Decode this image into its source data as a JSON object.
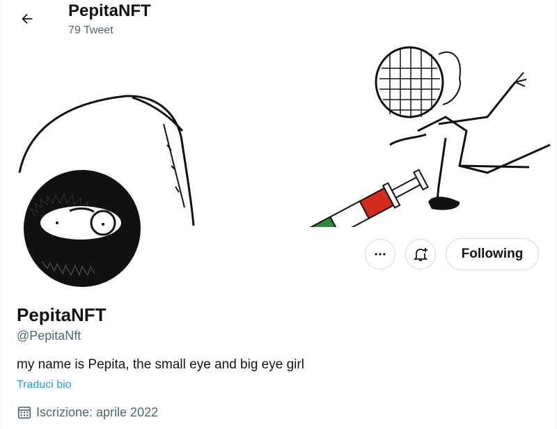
{
  "header": {
    "back_icon": "arrow-left-icon",
    "name": "PepitaNFT",
    "tweet_count": "79 Tweet"
  },
  "banner": {
    "description_icon": "banner-illustration",
    "syringe_colors": [
      "#2e8b3a",
      "#ffffff",
      "#d42b1e"
    ]
  },
  "actions": {
    "more_icon": "more-horizontal-icon",
    "notify_icon": "bell-plus-icon",
    "follow_label": "Following"
  },
  "profile": {
    "display_name": "PepitaNFT",
    "handle": "@PepitaNft",
    "bio": "my name is Pepita, the small eye and big eye girl",
    "translate_label": "Traduci bio",
    "joined_icon": "calendar-icon",
    "joined": "Iscrizione: aprile 2022"
  },
  "colors": {
    "accent": "#1d9bf0",
    "secondary_text": "#536471",
    "border": "#cfd9de"
  }
}
